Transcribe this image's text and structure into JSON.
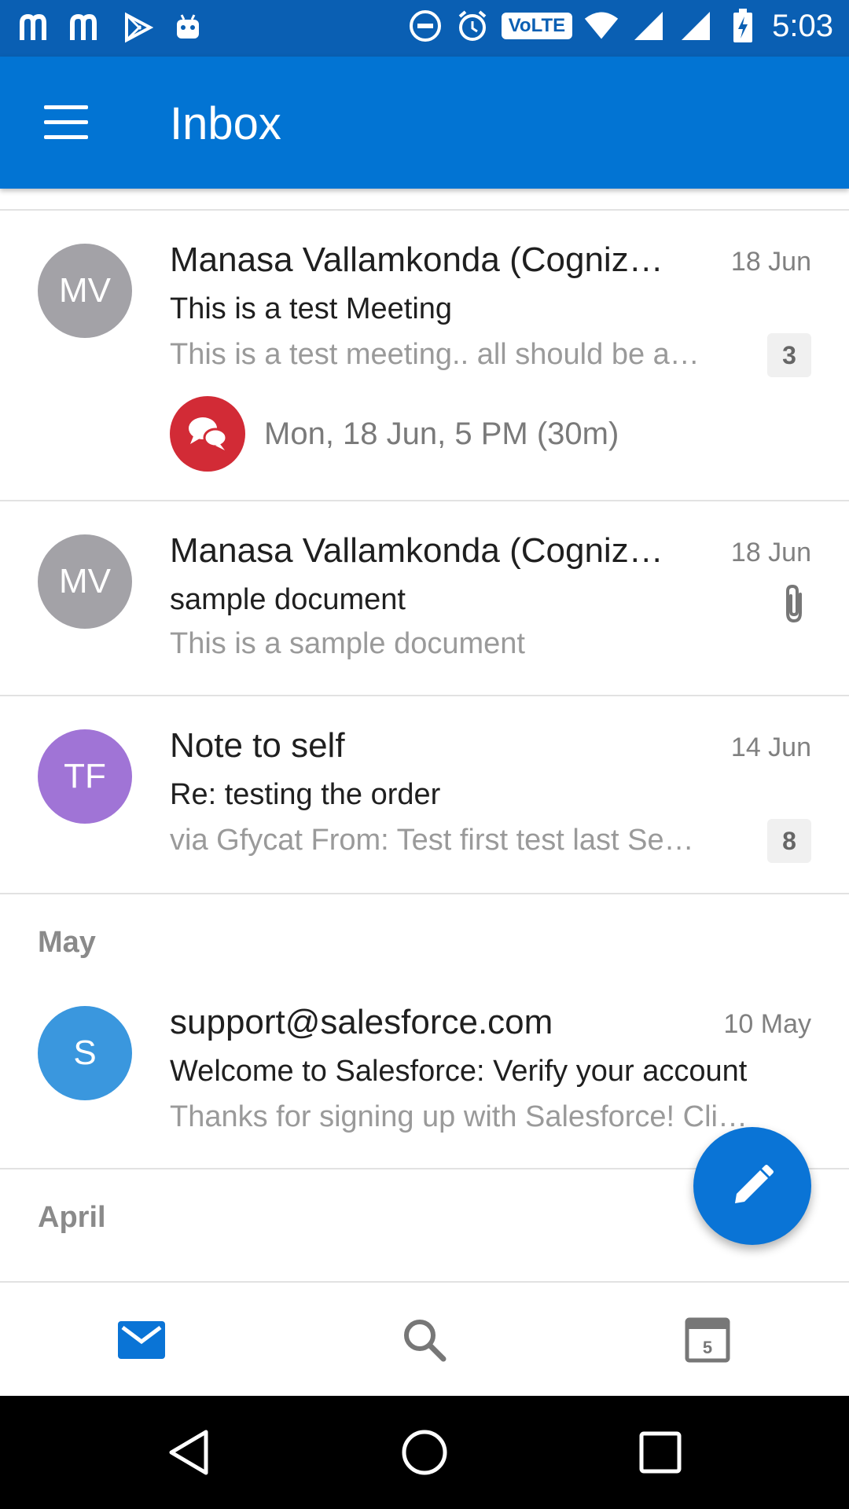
{
  "status_bar": {
    "time": "5:03",
    "volte_label": "VoLTE",
    "left_icons": [
      "mi-app-icon",
      "mi-app-icon",
      "play-store-icon",
      "android-icon"
    ],
    "right_icons": [
      "do-not-disturb-icon",
      "alarm-icon",
      "volte-icon",
      "wifi-icon",
      "signal-icon",
      "signal-icon",
      "battery-charging-icon"
    ]
  },
  "app_bar": {
    "title": "Inbox",
    "menu_icon": "hamburger-menu-icon"
  },
  "emails": [
    {
      "avatar": "MV",
      "avatar_color": "#a3a2a7",
      "sender": "Manasa Vallamkonda (Cogniz…",
      "date": "18 Jun",
      "subject": "This is a test Meeting",
      "preview": "This is a test meeting.. all should be a…",
      "count": "3",
      "event_text": "Mon, 18 Jun, 5 PM (30m)"
    },
    {
      "avatar": "MV",
      "avatar_color": "#a3a2a7",
      "sender": "Manasa Vallamkonda (Cogniz…",
      "date": "18 Jun",
      "subject": "sample document",
      "preview": "This is a sample document",
      "attachment_icon": "paperclip-icon"
    },
    {
      "avatar": "TF",
      "avatar_color": "#a074d6",
      "sender": "Note to self",
      "date": "14 Jun",
      "subject": "Re: testing the order",
      "preview": "via Gfycat From: Test first test last Se…",
      "count": "8"
    },
    {
      "avatar": "S",
      "avatar_color": "#3a97de",
      "sender": "support@salesforce.com",
      "date": "10 May",
      "subject": "Welcome to Salesforce: Verify your account",
      "preview": "Thanks for signing up with Salesforce! Cli…"
    }
  ],
  "sections": {
    "may": "May",
    "april": "April"
  },
  "fab": {
    "icon": "compose-pencil-icon",
    "color": "#0a74d6"
  },
  "tabs": [
    {
      "icon": "mail-icon",
      "active": true
    },
    {
      "icon": "search-icon",
      "active": false
    },
    {
      "icon": "calendar-icon",
      "calendar_day": "5",
      "active": false
    }
  ],
  "colors": {
    "status_bar": "#0a5fb3",
    "app_bar": "#0274d3",
    "accent": "#0a74d6",
    "event_red": "#d22b36"
  }
}
